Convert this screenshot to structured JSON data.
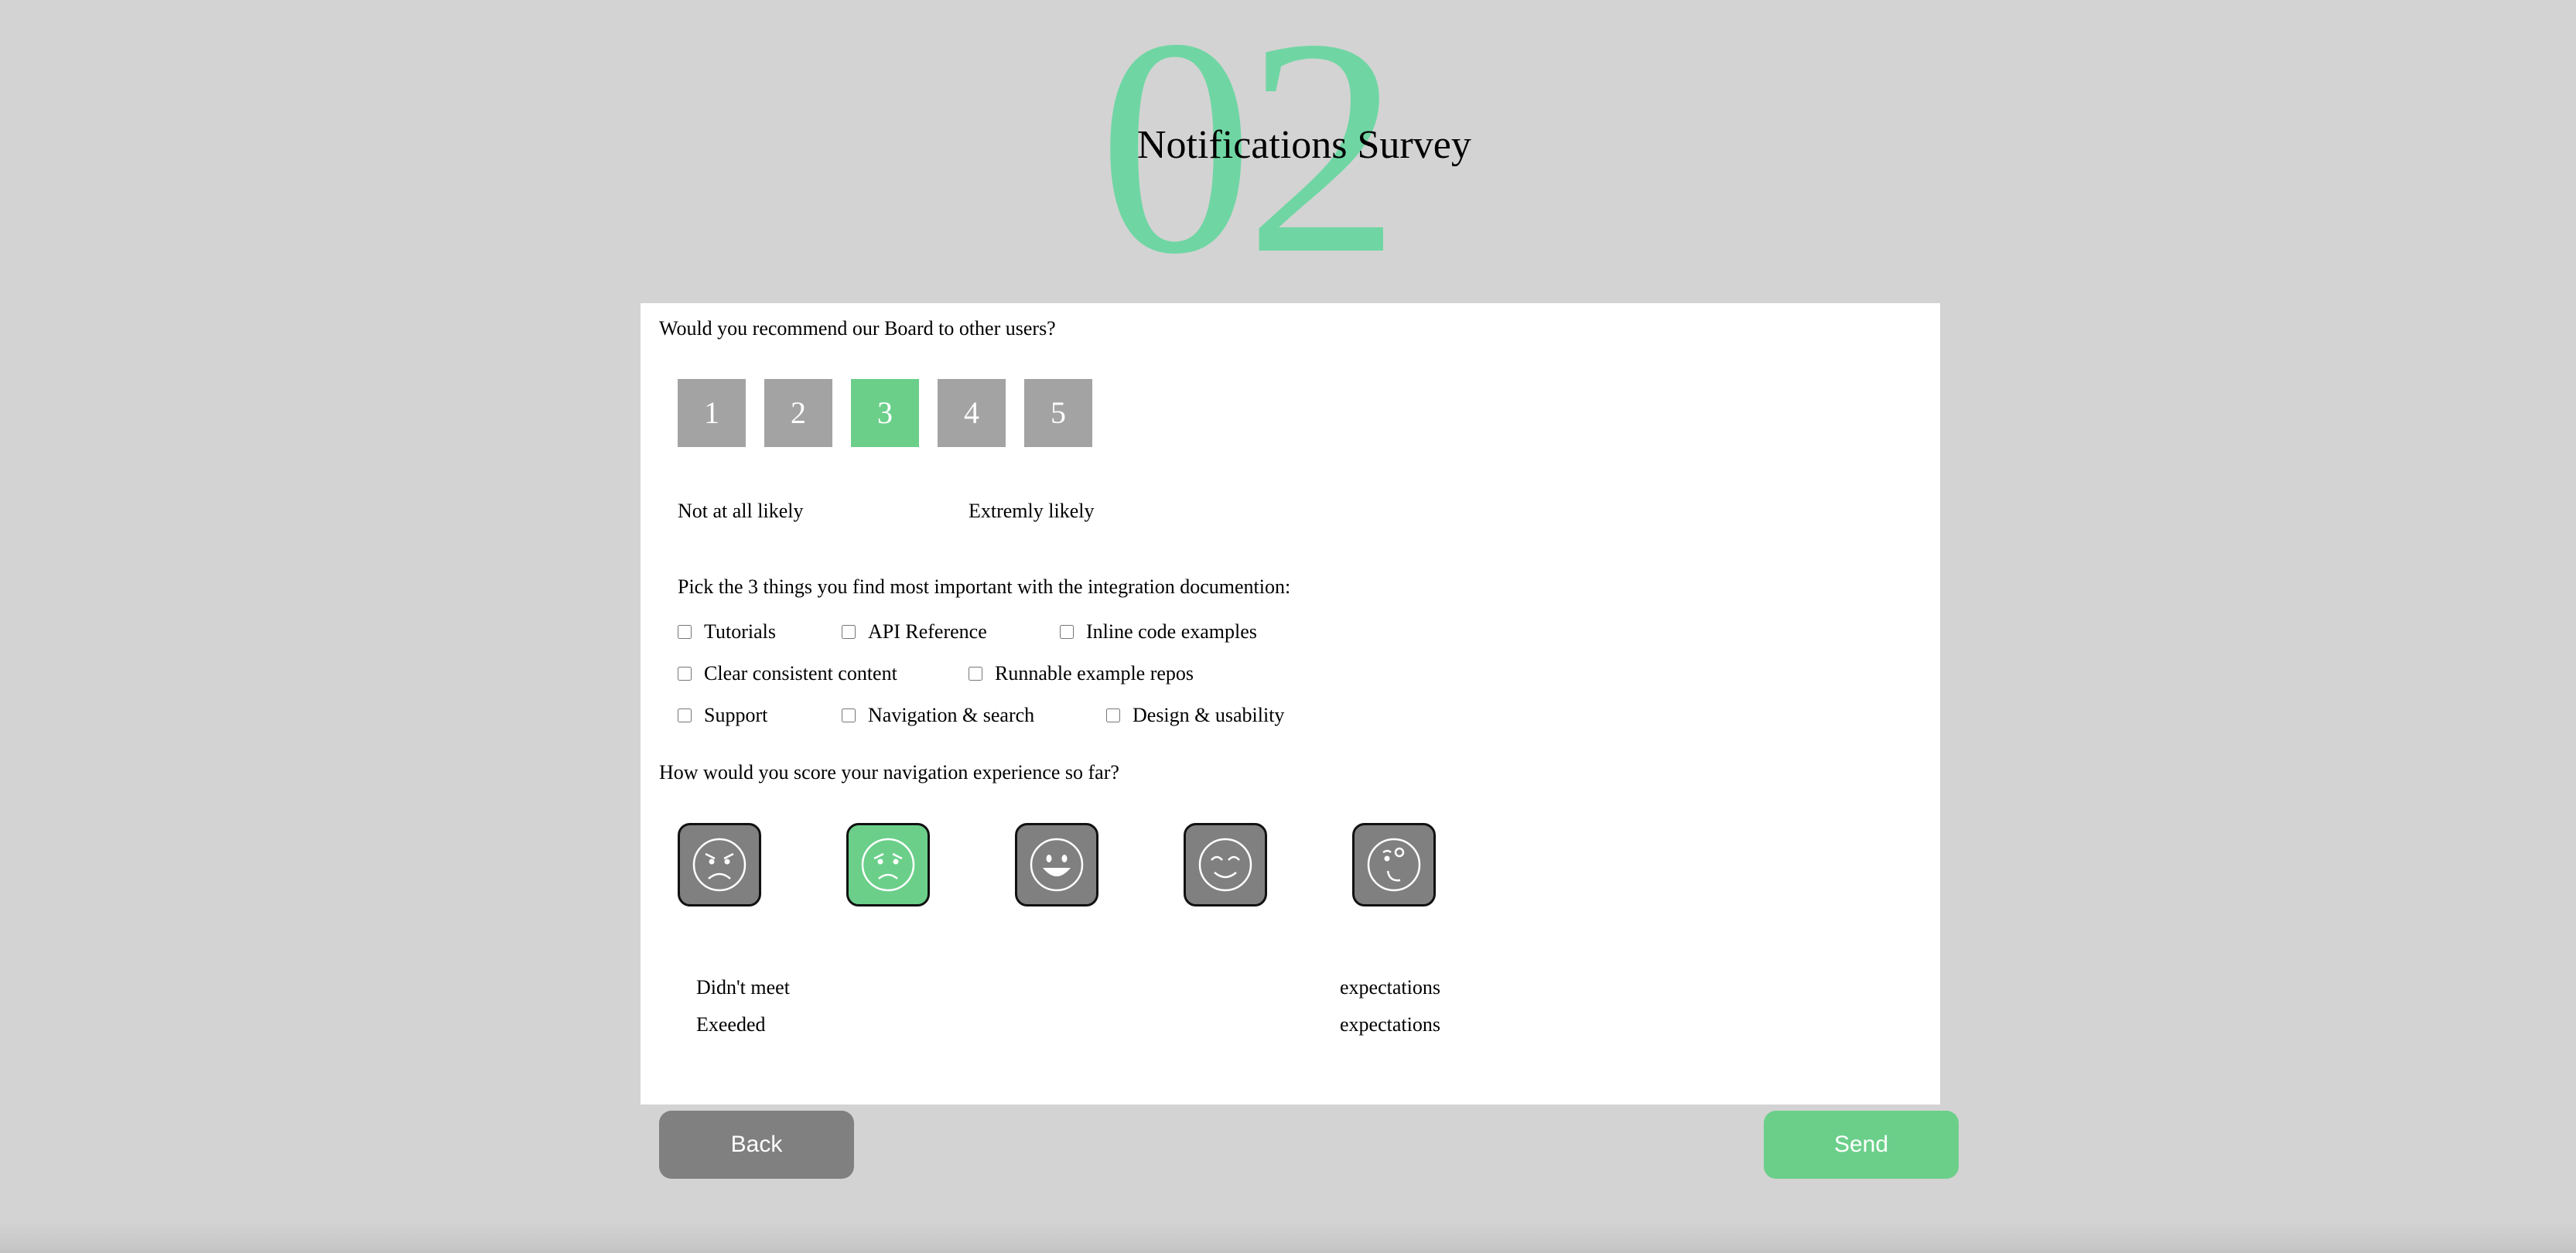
{
  "header": {
    "number": "02",
    "title": "Notifications Survey"
  },
  "survey": {
    "q1": "Would you recommend our Board to other users?",
    "scores": [
      "1",
      "2",
      "3",
      "4",
      "5"
    ],
    "selected_score": "3",
    "scale_low": "Not at all likely",
    "scale_high": "Extremly likely",
    "q2": "Pick the 3 things you find most important with the integration documention:",
    "options_row1": [
      "Tutorials",
      "API Reference",
      "Inline code examples"
    ],
    "options_row2": [
      "Clear consistent content",
      "Runnable example repos"
    ],
    "options_row3": [
      "Support",
      "Navigation & search",
      "Design & usability"
    ],
    "q3": "How would you score your navigation experience so far?",
    "faces": [
      "angry-face-icon",
      "worried-face-icon",
      "smiling-face-icon",
      "content-face-icon",
      "winking-face-icon"
    ],
    "selected_face": 1,
    "legend_left_1": "Didn't meet",
    "legend_left_2": "Exeeded",
    "legend_right_1": "expectations",
    "legend_right_2": "expectations"
  },
  "buttons": {
    "back": "Back",
    "send": "Send"
  },
  "colors": {
    "accent": "#6bcf8a",
    "hero": "#6fd6a3",
    "neutral": "#a3a3a3",
    "background": "#d3d3d3"
  }
}
